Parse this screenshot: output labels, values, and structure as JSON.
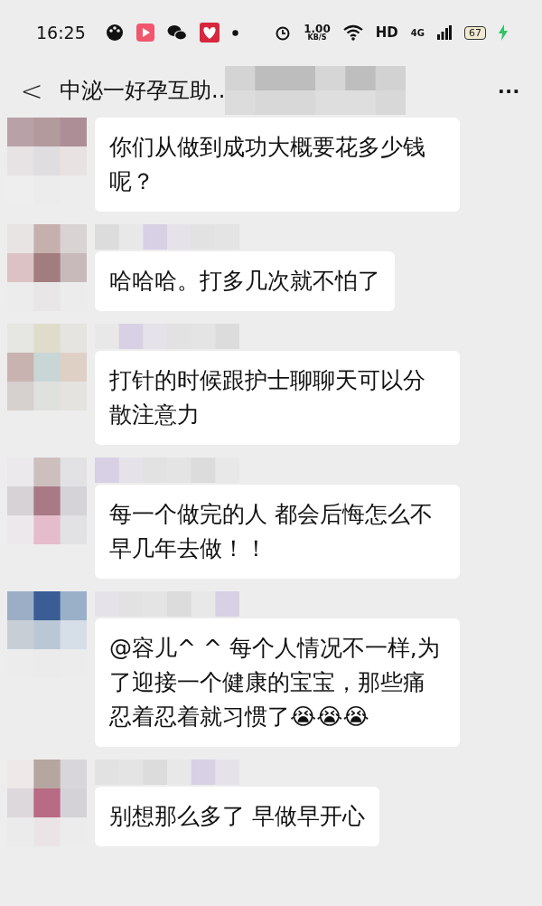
{
  "status_bar": {
    "time": "16:25",
    "speed_value": "1.00",
    "speed_unit": "KB/S",
    "network_hd": "HD",
    "network_type": "4G",
    "battery": "67"
  },
  "header": {
    "back": "<",
    "title": "中泌一好孕互助..",
    "more": "..."
  },
  "messages": [
    {
      "text": "你们从做到成功大概要花多少钱呢？",
      "show_name": false
    },
    {
      "text": "哈哈哈。打多几次就不怕了",
      "show_name": true
    },
    {
      "text": "打针的时候跟护士聊聊天可以分散注意力",
      "show_name": true
    },
    {
      "text": "每一个做完的人 都会后悔怎么不早几年去做！！",
      "show_name": true
    },
    {
      "text": "@容儿^ ^ 每个人情况不一样,为了迎接一个健康的宝宝，那些痛忍着忍着就习惯了😭😭😭",
      "show_name": true
    },
    {
      "text": "别想那么多了 早做早开心",
      "show_name": true
    }
  ]
}
